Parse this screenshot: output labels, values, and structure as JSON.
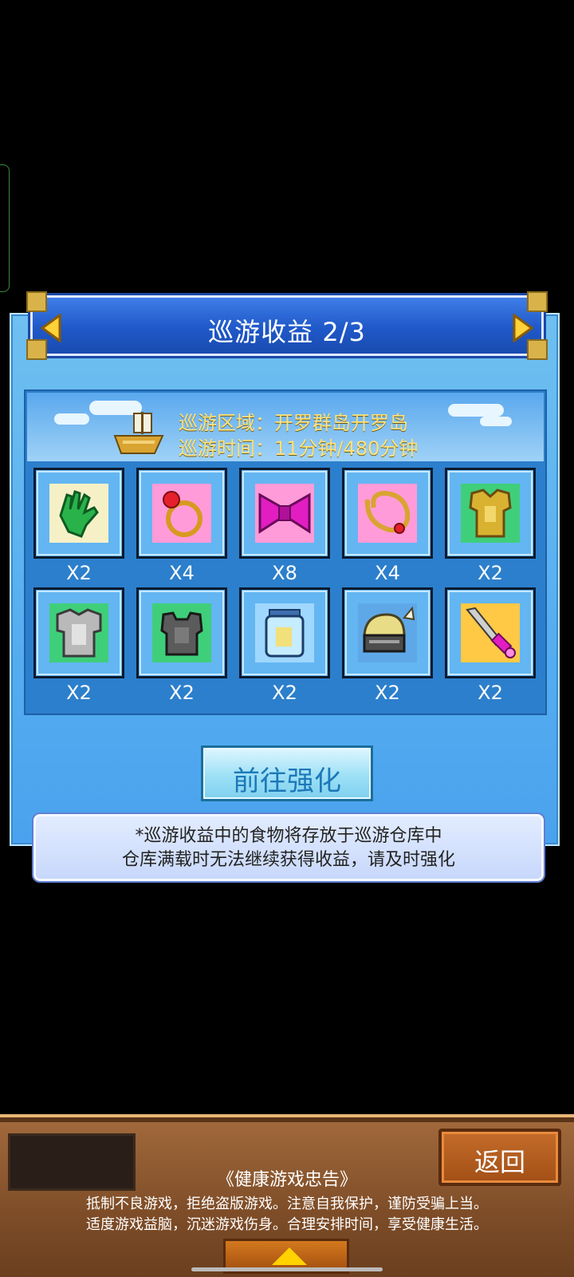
{
  "title_bar": {
    "title": "巡游收益 2/3"
  },
  "cruise": {
    "area_label": "巡游区域：开罗群岛开罗岛",
    "time_label": "巡游时间：11分钟/480分钟"
  },
  "items": [
    {
      "icon": "green-glove-icon",
      "qty": "X2",
      "bg": "#f6f0c6"
    },
    {
      "icon": "ruby-ring-icon",
      "qty": "X4",
      "bg": "#ff9bd8"
    },
    {
      "icon": "pink-bow-icon",
      "qty": "X8",
      "bg": "#ff9bd8"
    },
    {
      "icon": "gold-necklace-icon",
      "qty": "X4",
      "bg": "#ff9bd8"
    },
    {
      "icon": "gold-armor-icon",
      "qty": "X2",
      "bg": "#3fcf7a"
    },
    {
      "icon": "silver-armor-icon",
      "qty": "X2",
      "bg": "#3fcf7a"
    },
    {
      "icon": "dark-armor-icon",
      "qty": "X2",
      "bg": "#3fcf7a"
    },
    {
      "icon": "jar-icon",
      "qty": "X2",
      "bg": "#9fd7ff"
    },
    {
      "icon": "knight-helmet-icon",
      "qty": "X2",
      "bg": "#5fa8e8"
    },
    {
      "icon": "pink-sword-icon",
      "qty": "X2",
      "bg": "#ffc845"
    }
  ],
  "go_button": {
    "label": "前往强化"
  },
  "note": {
    "line1": "*巡游收益中的食物将存放于巡游仓库中",
    "line2": "仓库满载时无法继续获得收益，请及时强化"
  },
  "footer": {
    "back_label": "返回",
    "health_title": "《健康游戏忠告》",
    "health_line1": "抵制不良游戏，拒绝盗版游戏。注意自我保护，谨防受骗上当。",
    "health_line2": "适度游戏益脑，沉迷游戏伤身。合理安排时间，享受健康生活。"
  },
  "colors": {
    "info_text": "#ffe27a",
    "title_bar": "#1f58c8",
    "panel": "#56aef0"
  }
}
